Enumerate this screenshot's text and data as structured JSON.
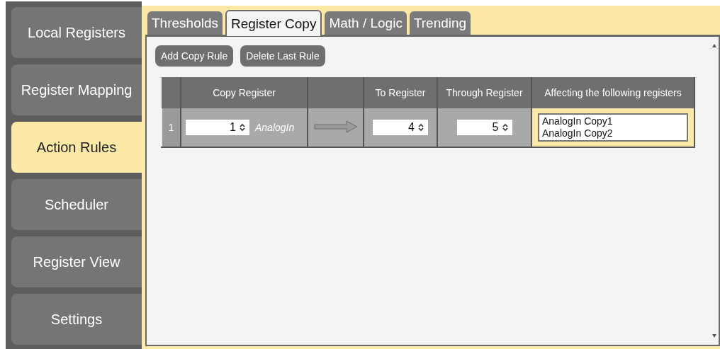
{
  "sidebar": {
    "items": [
      {
        "label": "Local Registers",
        "selected": false
      },
      {
        "label": "Register Mapping",
        "selected": false
      },
      {
        "label": "Action Rules",
        "selected": true
      },
      {
        "label": "Scheduler",
        "selected": false
      },
      {
        "label": "Register View",
        "selected": false
      },
      {
        "label": "Settings",
        "selected": false
      }
    ]
  },
  "tabs": [
    {
      "label": "Thresholds",
      "selected": false
    },
    {
      "label": "Register Copy",
      "selected": true
    },
    {
      "label": "Math / Logic",
      "selected": false
    },
    {
      "label": "Trending",
      "selected": false
    }
  ],
  "buttons": [
    "Add Copy Rule",
    "Delete Last Rule"
  ],
  "table": {
    "columns": [
      "Copy Register",
      "To Register",
      "Through Register",
      "Affecting the following registers"
    ],
    "rows": [
      {
        "index": "1",
        "copy_register": "1",
        "copy_name": "AnalogIn",
        "to_register": "4",
        "through_register": "5",
        "affecting": [
          "AnalogIn Copy1",
          "AnalogIn Copy2"
        ]
      }
    ]
  }
}
